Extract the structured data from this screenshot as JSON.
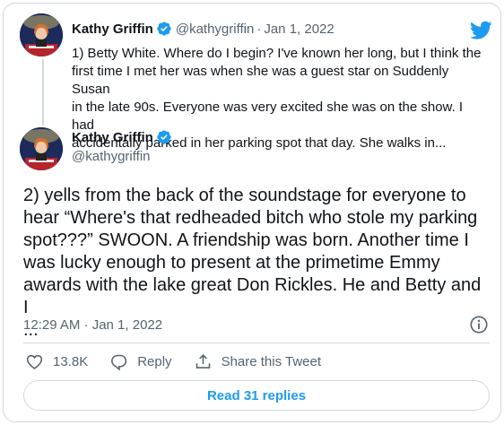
{
  "quoted_tweet": {
    "name": "Kathy Griffin",
    "handle": "@kathygriffin",
    "separator": "·",
    "date": "Jan 1, 2022",
    "text_lines": [
      "1) Betty White. Where do I begin? I've known her long, but I think the",
      "first time I met her was when she was a guest star on Suddenly Susan",
      "in the late 90s. Everyone was very excited she was on the show. I had",
      "accidentally parked in her parking spot that day. She walks in..."
    ]
  },
  "main_tweet": {
    "name": "Kathy Griffin",
    "handle": "@kathygriffin",
    "text_lines": [
      "2) yells from the back of the soundstage for everyone to",
      "hear “Where's that redheaded bitch who stole my parking",
      "spot???” SWOON. A friendship was born. Another time I",
      "was lucky enough to present at the primetime Emmy",
      "awards with the lake great Don Rickles. He and Betty and I",
      "..."
    ],
    "timestamp": "12:29 AM · Jan 1, 2022"
  },
  "actions": {
    "like_count": "13.8K",
    "reply_label": "Reply",
    "share_label": "Share this Tweet"
  },
  "read_replies_label": "Read 31 replies",
  "colors": {
    "accent": "#1d9bf0",
    "like_red": "#f91880",
    "text_secondary": "#536471",
    "border": "#cfd9de"
  },
  "icons": [
    "verified-badge-icon",
    "twitter-bird-icon",
    "info-icon",
    "heart-icon",
    "reply-icon",
    "share-icon"
  ]
}
